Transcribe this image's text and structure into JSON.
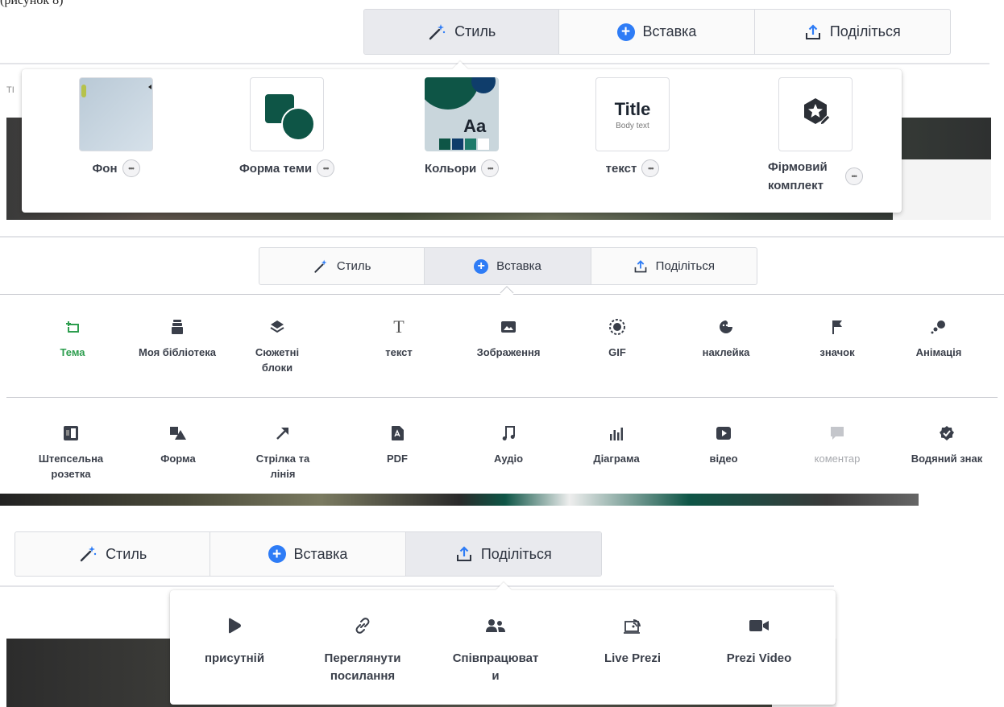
{
  "top_left_fragment": "(рисунок 8)",
  "edge_fragment": "ТІ",
  "toolbar": {
    "style_label": "Стиль",
    "insert_label": "Вставка",
    "share_label": "Поділіться"
  },
  "style_menu": {
    "items": [
      {
        "label": "Фон"
      },
      {
        "label": "Форма теми"
      },
      {
        "label": "Кольори"
      },
      {
        "label": "текст"
      },
      {
        "label_line1": "Фірмовий",
        "label_line2": "комплект"
      }
    ],
    "text_thumb_title": "Title",
    "text_thumb_body": "Body text",
    "colors_thumb_text": "Aa"
  },
  "insert_menu": {
    "row1": [
      {
        "label": "Тема",
        "icon": "theme-icon"
      },
      {
        "label": "Моя бібліотека",
        "icon": "library-icon"
      },
      {
        "label_line1": "Сюжетні",
        "label_line2": "блоки",
        "icon": "layers-icon"
      },
      {
        "label": "текст",
        "icon": "text-icon"
      },
      {
        "label": "Зображення",
        "icon": "image-icon"
      },
      {
        "label": "GIF",
        "icon": "gif-icon"
      },
      {
        "label": "наклейка",
        "icon": "sticker-icon"
      },
      {
        "label": "значок",
        "icon": "flag-icon"
      },
      {
        "label": "Анімація",
        "icon": "animation-icon"
      }
    ],
    "row2": [
      {
        "label_line1": "Штепсельна",
        "label_line2": "розетка",
        "icon": "plugin-icon"
      },
      {
        "label": "Форма",
        "icon": "shape-icon"
      },
      {
        "label_line1": "Стрілка та",
        "label_line2": "лінія",
        "icon": "arrow-icon"
      },
      {
        "label": "PDF",
        "icon": "pdf-icon"
      },
      {
        "label": "Аудіо",
        "icon": "music-icon"
      },
      {
        "label": "Діаграма",
        "icon": "chart-icon"
      },
      {
        "label": "відео",
        "icon": "play-icon"
      },
      {
        "label": "коментар",
        "icon": "comment-icon"
      },
      {
        "label": "Водяний знак",
        "icon": "watermark-icon"
      }
    ],
    "active_color": "#2e9e4f",
    "disabled_color": "#a7a9ae"
  },
  "share_menu": {
    "items": [
      {
        "label": "присутній",
        "icon": "present-icon"
      },
      {
        "label_line1": "Переглянути",
        "label_line2": "посилання",
        "icon": "link-icon"
      },
      {
        "label_line1": "Співпрацюват",
        "label_line2": "и",
        "icon": "collaborate-icon"
      },
      {
        "label": "Live Prezi",
        "icon": "live-icon"
      },
      {
        "label": "Prezi Video",
        "icon": "video-camera-icon"
      }
    ]
  },
  "colors": {
    "accent_blue": "#2e7cf6",
    "theme_green": "#0e5546",
    "theme_navy": "#0f3d6b"
  }
}
